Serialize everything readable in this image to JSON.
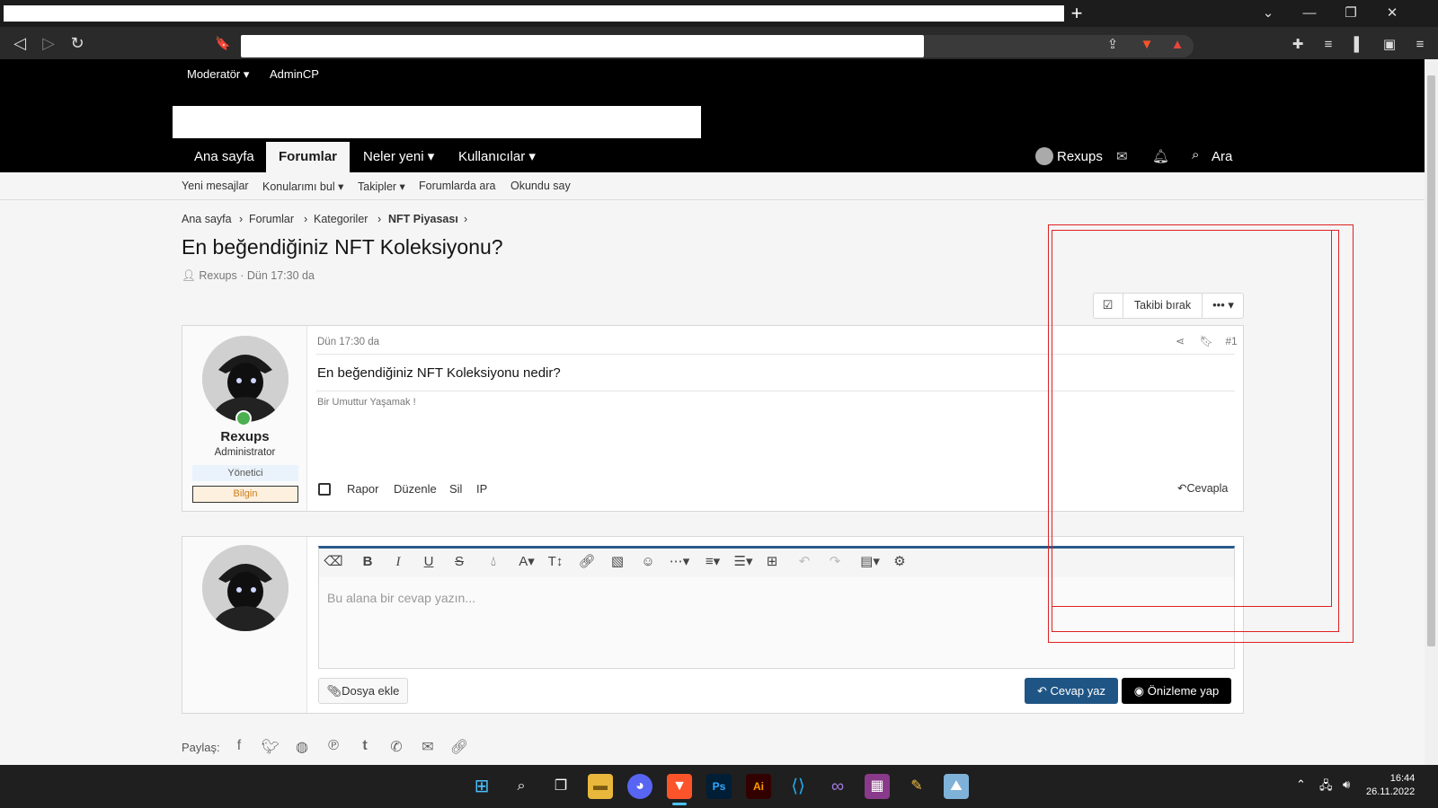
{
  "window": {
    "controls": [
      "⌄",
      "—",
      "❐",
      "✕"
    ]
  },
  "browser": {
    "nav": [
      "◁",
      "▷",
      "↻",
      "🔖"
    ]
  },
  "staffbar": {
    "moderator": "Moderatör ▾",
    "admincp": "AdminCP"
  },
  "nav": {
    "tabs": [
      {
        "label": "Ana sayfa"
      },
      {
        "label": "Forumlar"
      },
      {
        "label": "Neler yeni ▾"
      },
      {
        "label": "Kullanıcılar ▾"
      }
    ],
    "user": "Rexups",
    "search": "Ara"
  },
  "subnav": {
    "items": [
      "Yeni mesajlar",
      "Konularımı bul ▾",
      "Takipler ▾",
      "Forumlarda ara",
      "Okundu say"
    ]
  },
  "breadcrumb": [
    "Ana sayfa",
    "›",
    "Forumlar",
    "›",
    "Kategoriler",
    "›",
    "NFT Piyasası",
    "›"
  ],
  "thread": {
    "title": "En beğendiğiniz NFT Koleksiyonu?",
    "meta": "Rexups · Dün 17:30 da",
    "watch_label": "Takibi bırak",
    "more": "••• ▾"
  },
  "post": {
    "date": "Dün 17:30 da",
    "number": "#1",
    "body": "En beğendiğiniz NFT Koleksiyonu nedir?",
    "signature": "Bir Umuttur Yaşamak !",
    "username": "Rexups",
    "user_title": "Administrator",
    "banner1": "Yönetici",
    "banner2": "Bilgin",
    "actions": [
      "Rapor",
      "Düzenle",
      "Sil",
      "IP"
    ],
    "reply": "Cevapla"
  },
  "editor": {
    "placeholder": "Bu alana bir cevap yazın...",
    "attach": "Dosya ekle",
    "submit": "Cevap yaz",
    "preview": "Önizleme yap",
    "tools": [
      "eraser-icon",
      "bold-icon",
      "italic-icon",
      "underline-icon",
      "strike-icon",
      "color-icon",
      "font-icon",
      "size-icon",
      "link-icon",
      "image-icon",
      "emoji-icon",
      "more-icon",
      "align-icon",
      "list-icon",
      "table-icon",
      "undo-icon",
      "redo-icon",
      "save-icon",
      "settings-icon"
    ]
  },
  "share": {
    "label": "Paylaş:",
    "icons": [
      "facebook-icon",
      "twitter-icon",
      "reddit-icon",
      "pinterest-icon",
      "tumblr-icon",
      "whatsapp-icon",
      "email-icon",
      "link-icon"
    ]
  },
  "taskbar": {
    "time": "16:44",
    "date": "26.11.2022",
    "apps": [
      "windows-start-icon",
      "search-icon",
      "task-view-icon",
      "file-explorer-icon",
      "discord-icon",
      "brave-icon",
      "photoshop-icon",
      "illustrator-icon",
      "vscode-icon",
      "visual-studio-icon",
      "winrar-icon",
      "paint-tool-icon",
      "photos-icon"
    ],
    "app_labels": {
      "photoshop": "Ps",
      "illustrator": "Ai"
    }
  },
  "colors": {
    "accent": "#1f5585",
    "header_bg": "#000000",
    "page_bg": "#f5f5f5",
    "overlay": "#e02020"
  }
}
